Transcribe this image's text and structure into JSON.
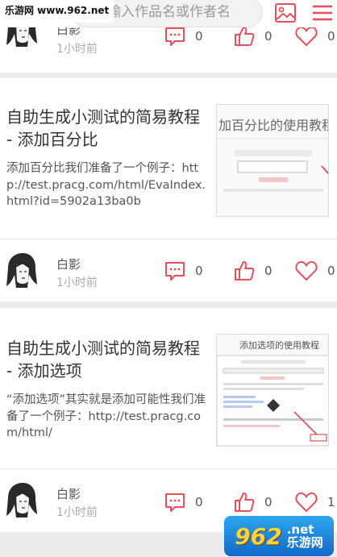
{
  "watermark": {
    "top": "乐游网 www.962.net",
    "logo_num": "962",
    "logo_tld": ".net",
    "logo_text": "乐游网"
  },
  "search": {
    "placeholder": "输入作品名或作者名"
  },
  "colors": {
    "accent": "#e84f5a",
    "text": "#333333",
    "muted": "#aaaaaa"
  },
  "icons": {
    "search": "search-icon",
    "image": "image-icon",
    "menu": "menu-icon",
    "comment": "comment-icon",
    "like": "thumbs-up-icon",
    "favorite": "heart-icon"
  },
  "posts": [
    {
      "author": "白影",
      "time": "1小时前",
      "comments": "0",
      "likes": "0",
      "favorites": "0"
    },
    {
      "title": "自助生成小测试的简易教程 - 添加百分比",
      "excerpt": "添加百分比我们准备了一个例子：http://test.pracg.com/html/EvaIndex.html?id=5902a13ba0b",
      "thumb_title": "加百分比的使用教程",
      "author": "白影",
      "time": "1小时前",
      "comments": "0",
      "likes": "0",
      "favorites": "0"
    },
    {
      "title": "自助生成小测试的简易教程 - 添加选项",
      "excerpt": "“添加选项”其实就是添加可能性我们准备了一个例子：http://test.pracg.com/html/",
      "thumb_title": "添加选项的使用教程",
      "author": "白影",
      "time": "1小时前",
      "comments": "0",
      "likes": "0",
      "favorites": "1"
    }
  ]
}
